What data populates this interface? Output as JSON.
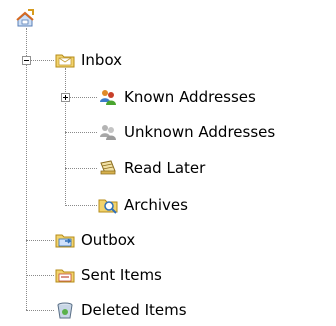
{
  "tree": {
    "root": {
      "icon": "home-mail-icon"
    },
    "inbox": {
      "label": "Inbox",
      "icon": "inbox-folder-icon",
      "expanded": true,
      "children": [
        {
          "label": "Known Addresses",
          "icon": "contacts-group-icon",
          "expanded": false
        },
        {
          "label": "Unknown Addresses",
          "icon": "unknown-contacts-icon"
        },
        {
          "label": "Read Later",
          "icon": "notebook-icon"
        },
        {
          "label": "Archives",
          "icon": "archive-search-folder-icon"
        }
      ]
    },
    "outbox": {
      "label": "Outbox",
      "icon": "outbox-folder-icon"
    },
    "sent": {
      "label": "Sent Items",
      "icon": "sent-items-folder-icon"
    },
    "deleted": {
      "label": "Deleted Items",
      "icon": "trash-can-icon"
    }
  }
}
